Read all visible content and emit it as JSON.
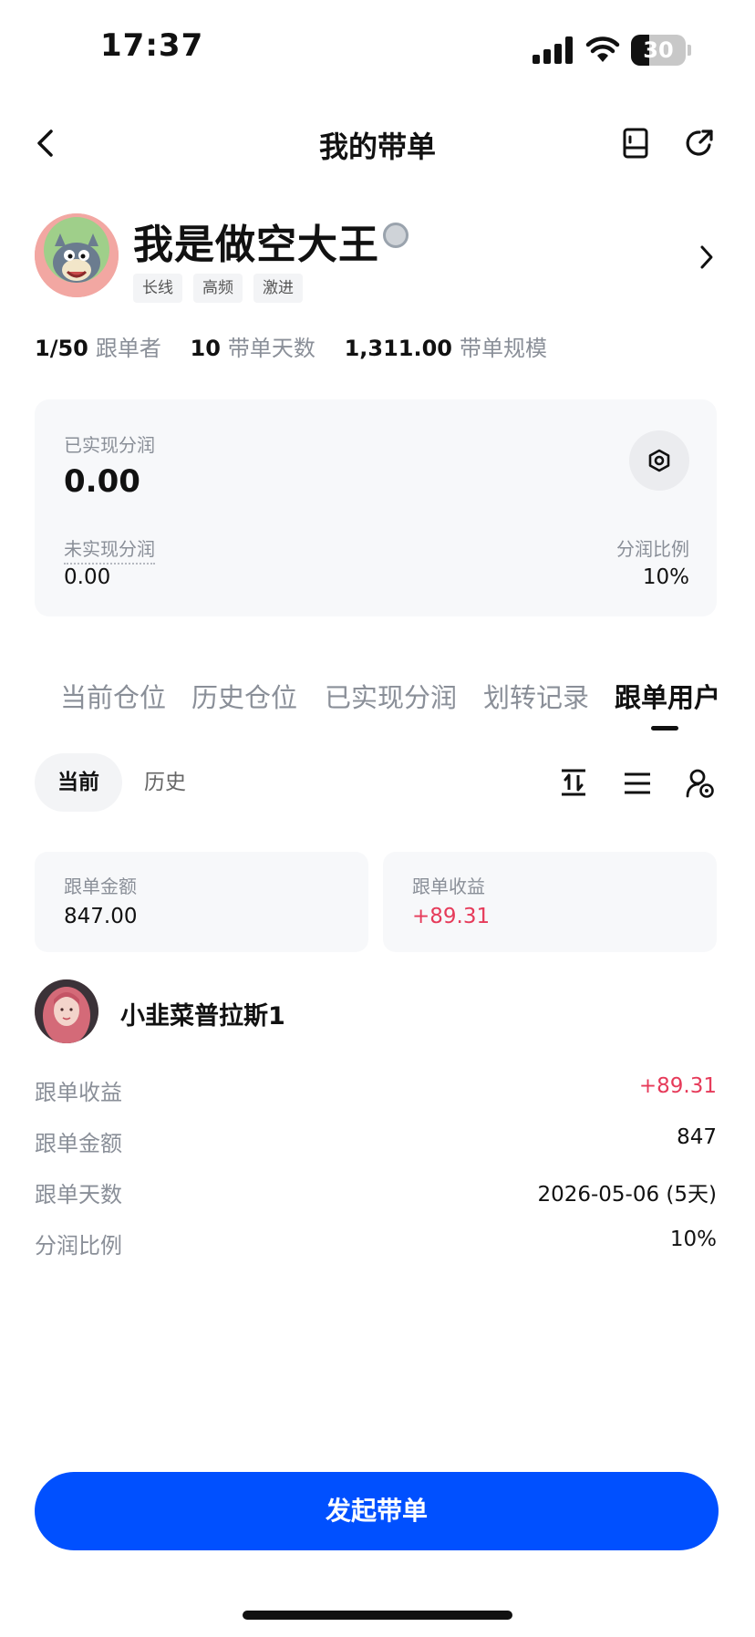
{
  "status_bar": {
    "time": "17:37",
    "battery": "30"
  },
  "header": {
    "title": "我的带单",
    "icons": [
      "back-chevron-icon",
      "book-icon",
      "share-icon"
    ]
  },
  "profile": {
    "name": "我是做空大王",
    "tags": [
      "长线",
      "高频",
      "激进"
    ],
    "stats": [
      {
        "value": "1/50",
        "label": "跟单者"
      },
      {
        "value": "10",
        "label": "带单天数"
      },
      {
        "value": "1,311.00",
        "label": "带单规模"
      }
    ]
  },
  "share_card": {
    "realized_label": "已实现分润",
    "realized_value": "0.00",
    "unrealized_label": "未实现分润",
    "unrealized_value": "0.00",
    "ratio_label": "分润比例",
    "ratio_value": "10%"
  },
  "tabs": [
    "当前仓位",
    "历史仓位",
    "已实现分润",
    "划转记录",
    "跟单用户"
  ],
  "active_tab": "跟单用户",
  "sub_tabs": {
    "current": "当前",
    "history": "历史"
  },
  "summary": {
    "amount_label": "跟单金额",
    "amount_value": "847.00",
    "profit_label": "跟单收益",
    "profit_value": "+89.31"
  },
  "follower": {
    "name": "小韭菜普拉斯1",
    "rows": [
      {
        "label": "跟单收益",
        "value": "+89.31"
      },
      {
        "label": "跟单金额",
        "value": "847"
      },
      {
        "label": "跟单天数",
        "value": "2026-05-06 (5天)"
      },
      {
        "label": "分润比例",
        "value": "10%"
      }
    ]
  },
  "cta": "发起带单",
  "colors": {
    "primary": "#0050ff",
    "positive": "#e63b5a",
    "muted": "#8a8f98",
    "card_bg": "#f7f8fa"
  }
}
